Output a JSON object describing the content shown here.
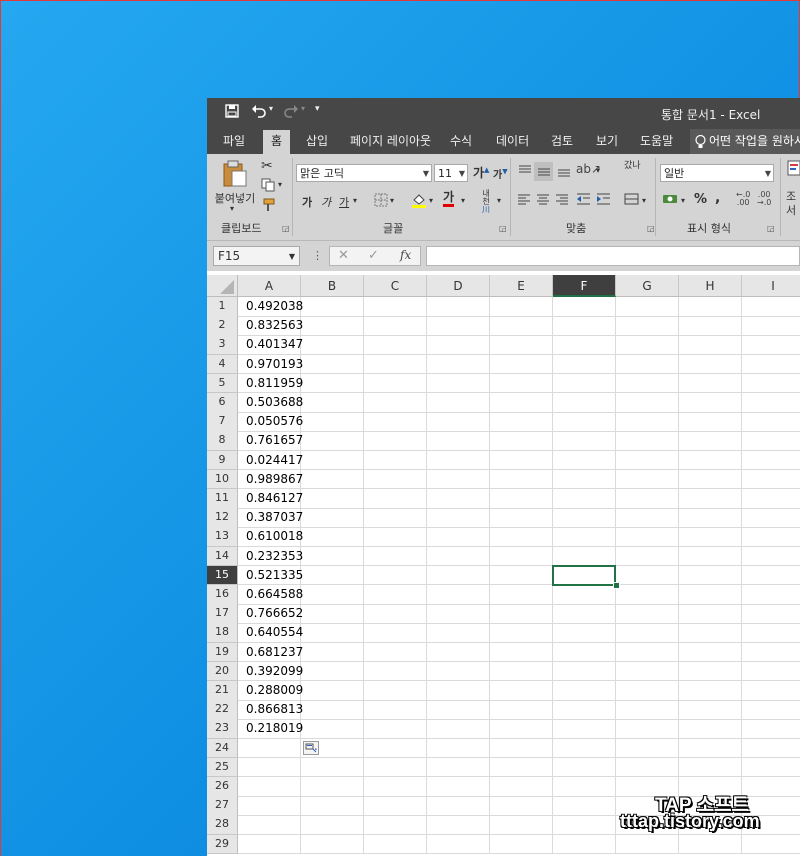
{
  "window": {
    "title": "통합 문서1 - Excel"
  },
  "tabs": [
    "파일",
    "홈",
    "삽입",
    "페이지 레이아웃",
    "수식",
    "데이터",
    "검토",
    "보기",
    "도움말"
  ],
  "tell_me": "어떤 작업을 원하시",
  "ribbon": {
    "paste_label": "붙여넣기",
    "font_name": "맑은 고딕",
    "font_size": "11",
    "number_format": "일반",
    "groups": {
      "clipboard": "클립보드",
      "font": "글꼴",
      "alignment": "맞춤",
      "number": "표시 형식"
    },
    "styles_partial": [
      "조",
      "서"
    ],
    "bold": "가",
    "italic": "가",
    "underline": "가",
    "grow_font": "가",
    "shrink_font": "가",
    "font_color_glyph": "가",
    "phonetic": "내천",
    "wrap": "갔나",
    "accounting": "₩",
    "percent": "%",
    "comma": ","
  },
  "formula_bar": {
    "name_box": "F15",
    "fx": "fx",
    "formula": ""
  },
  "columns": [
    "A",
    "B",
    "C",
    "D",
    "E",
    "F",
    "G",
    "H",
    "I"
  ],
  "selected_column": "F",
  "selected_row": "15",
  "rows": [
    "1",
    "2",
    "3",
    "4",
    "5",
    "6",
    "7",
    "8",
    "9",
    "10",
    "11",
    "12",
    "13",
    "14",
    "15",
    "16",
    "17",
    "18",
    "19",
    "20",
    "21",
    "22",
    "23",
    "24",
    "25",
    "26",
    "27",
    "28",
    "29"
  ],
  "column_a_values": [
    "0.492038",
    "0.832563",
    "0.401347",
    "0.970193",
    "0.811959",
    "0.503688",
    "0.050576",
    "0.761657",
    "0.024417",
    "0.989867",
    "0.846127",
    "0.387037",
    "0.610018",
    "0.232353",
    "0.521335",
    "0.664588",
    "0.766652",
    "0.640554",
    "0.681237",
    "0.392099",
    "0.288009",
    "0.866813",
    "0.218019"
  ],
  "watermark": {
    "line1": "TAP 소프트",
    "line2": "tttap.tistory.com"
  },
  "colors": {
    "desktop": "#1699e8",
    "titlebar": "#474747",
    "ribbon": "#d4d4d4",
    "selection": "#217346"
  }
}
